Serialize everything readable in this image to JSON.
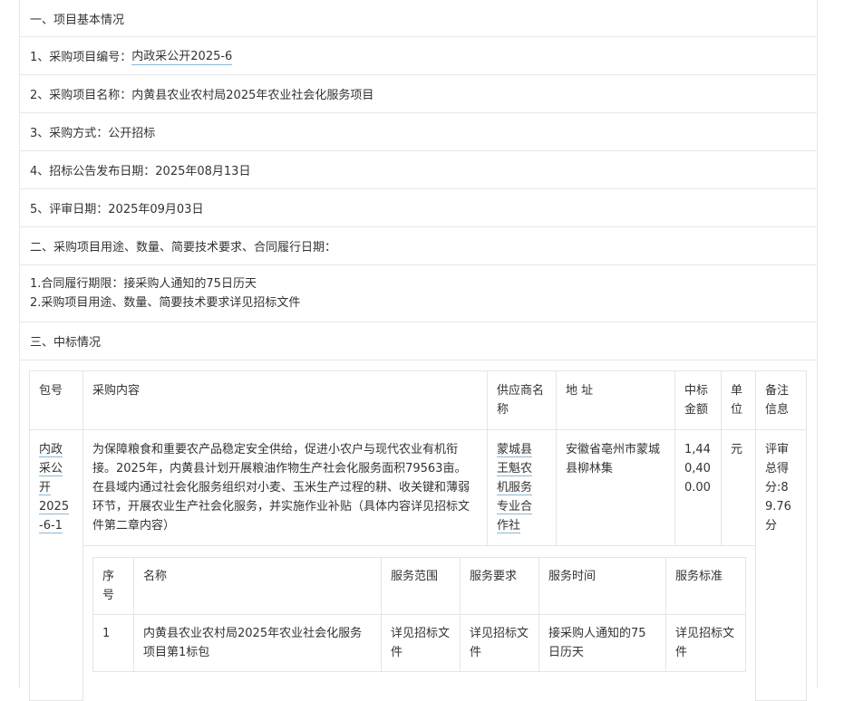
{
  "basic": {
    "heading": "一、项目基本情况",
    "project_no_label": "1、采购项目编号：",
    "project_no": "内政采公开2025-6",
    "project_name": "2、采购项目名称：内黄县农业农村局2025年农业社会化服务项目",
    "method": "3、采购方式：公开招标",
    "publish_date": "4、招标公告发布日期：2025年08月13日",
    "review_date": "5、评审日期：2025年09月03日"
  },
  "usage": {
    "heading": "二、采购项目用途、数量、简要技术要求、合同履行日期：",
    "line1": "1.合同履行期限：接采购人通知的75日历天",
    "line2": "2.采购项目用途、数量、简要技术要求详见招标文件"
  },
  "award": {
    "heading": "三、中标情况",
    "headers": {
      "pkg": "包号",
      "content": "采购内容",
      "supplier": "供应商名称",
      "address": "地 址",
      "amount": "中标金额",
      "unit": "单位",
      "remark": "备注信息"
    },
    "row": {
      "pkg_lines": [
        "内政",
        "采公",
        "开",
        "2025",
        "-6-1"
      ],
      "content": "为保障粮食和重要农产品稳定安全供给，促进小农户与现代农业有机衔接。2025年，内黄县计划开展粮油作物生产社会化服务面积79563亩。在县域内通过社会化服务组织对小麦、玉米生产过程的耕、收关键和薄弱环节，开展农业生产社会化服务，并实施作业补贴（具体内容详见招标文件第二章内容）",
      "supplier_lines": [
        "蒙城县",
        "王魁农",
        "机服务",
        "专业合",
        "作社"
      ],
      "address": "安徽省亳州市蒙城县柳林集",
      "amount": "1,440,400.00",
      "unit": "元",
      "remark": "评审总得分:89.76分"
    },
    "sub": {
      "headers": {
        "seq": "序号",
        "name": "名称",
        "scope": "服务范围",
        "req": "服务要求",
        "time": "服务时间",
        "std": "服务标准"
      },
      "row": {
        "seq": "1",
        "name": "内黄县农业农村局2025年农业社会化服务项目第1标包",
        "scope": "详见招标文件",
        "req": "详见招标文件",
        "time": "接采购人通知的75日历天",
        "std": "详见招标文件"
      }
    }
  }
}
